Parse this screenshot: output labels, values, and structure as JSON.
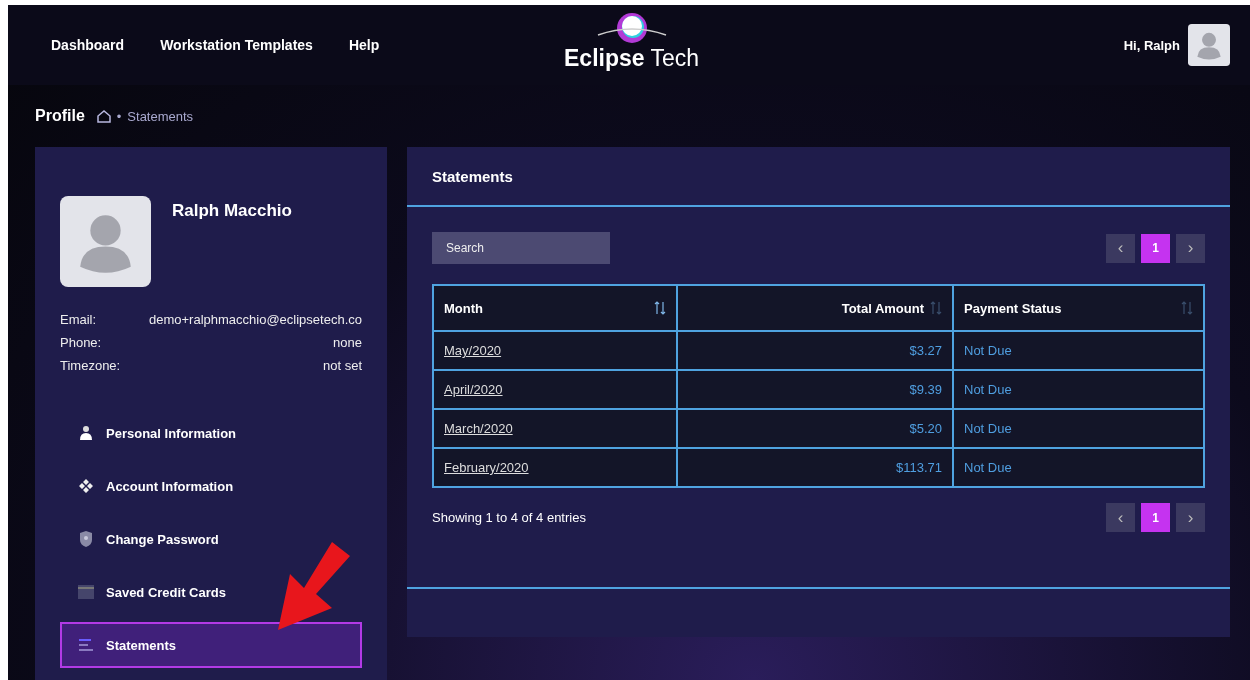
{
  "nav": {
    "links": [
      "Dashboard",
      "Workstation Templates",
      "Help"
    ],
    "logo": {
      "bold": "Eclipse",
      "light": "Tech"
    },
    "greeting": "Hi, Ralph"
  },
  "breadcrumb": {
    "title": "Profile",
    "separator": "•",
    "current": "Statements"
  },
  "profile": {
    "name": "Ralph Macchio",
    "fields": [
      {
        "label": "Email:",
        "value": "demo+ralphmacchio@eclipsetech.co"
      },
      {
        "label": "Phone:",
        "value": "none"
      },
      {
        "label": "Timezone:",
        "value": "not set"
      }
    ]
  },
  "sidebar": {
    "items": [
      {
        "label": "Personal Information",
        "selected": false
      },
      {
        "label": "Account Information",
        "selected": false
      },
      {
        "label": "Change Password",
        "selected": false
      },
      {
        "label": "Saved Credit Cards",
        "selected": false
      },
      {
        "label": "Statements",
        "selected": true
      }
    ]
  },
  "annotation": {
    "kind": "arrow"
  },
  "statements": {
    "title": "Statements",
    "search": {
      "placeholder": "Search"
    },
    "pagination_top": {
      "prev": "‹",
      "next": "›",
      "pages": [
        {
          "label": "1",
          "selected": true
        }
      ]
    },
    "table": {
      "columns": [
        {
          "label": "Month",
          "kind": "text",
          "sorted": true
        },
        {
          "label": "Total Amount",
          "kind": "number",
          "sorted": false
        },
        {
          "label": "Payment Status",
          "kind": "text",
          "sorted": false
        }
      ],
      "rows": [
        {
          "month": "May/2020",
          "amount": "$3.27",
          "status": "Not Due"
        },
        {
          "month": "April/2020",
          "amount": "$9.39",
          "status": "Not Due"
        },
        {
          "month": "March/2020",
          "amount": "$5.20",
          "status": "Not Due"
        },
        {
          "month": "February/2020",
          "amount": "$113.71",
          "status": "Not Due"
        }
      ]
    },
    "info": "Showing 1 to 4 of 4 entries",
    "pagination_bottom": {
      "prev": "‹",
      "next": "›",
      "pages": [
        {
          "label": "1",
          "selected": true
        }
      ]
    }
  }
}
